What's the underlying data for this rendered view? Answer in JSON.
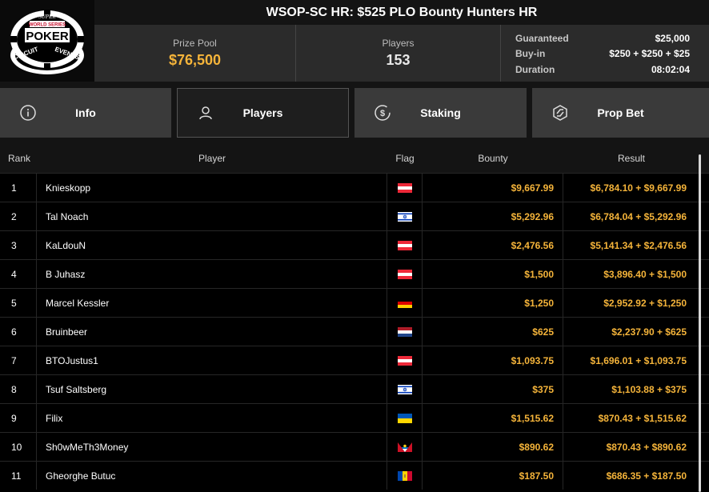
{
  "header": {
    "title": "WSOP-SC HR: $525 PLO Bounty Hunters HR",
    "logo": {
      "top_text": "SUPER",
      "middle_top": "WORLD SERIES",
      "brand": "POKER",
      "left_arc": "CIRCUIT",
      "right_arc": "EVENTS"
    }
  },
  "stats": {
    "prize_pool_label": "Prize Pool",
    "prize_pool_value": "$76,500",
    "players_label": "Players",
    "players_value": "153",
    "details": [
      {
        "label": "Guaranteed",
        "value": "$25,000"
      },
      {
        "label": "Buy-in",
        "value": "$250 + $250 + $25"
      },
      {
        "label": "Duration",
        "value": "08:02:04"
      }
    ]
  },
  "tabs": [
    {
      "label": "Info",
      "icon": "info-icon",
      "active": false
    },
    {
      "label": "Players",
      "icon": "user-icon",
      "active": true
    },
    {
      "label": "Staking",
      "icon": "dollar-coin-icon",
      "active": false
    },
    {
      "label": "Prop Bet",
      "icon": "prop-bet-icon",
      "active": false
    }
  ],
  "table": {
    "headers": {
      "rank": "Rank",
      "player": "Player",
      "flag": "Flag",
      "bounty": "Bounty",
      "result": "Result"
    },
    "rows": [
      {
        "rank": "1",
        "player": "Knieskopp",
        "flag": "austria",
        "bounty": "$9,667.99",
        "result": "$6,784.10 + $9,667.99"
      },
      {
        "rank": "2",
        "player": "Tal Noach",
        "flag": "israel",
        "bounty": "$5,292.96",
        "result": "$6,784.04 + $5,292.96"
      },
      {
        "rank": "3",
        "player": "KaLdouN",
        "flag": "austria",
        "bounty": "$2,476.56",
        "result": "$5,141.34 + $2,476.56"
      },
      {
        "rank": "4",
        "player": "B Juhasz",
        "flag": "austria",
        "bounty": "$1,500",
        "result": "$3,896.40 + $1,500"
      },
      {
        "rank": "5",
        "player": "Marcel Kessler",
        "flag": "germany",
        "bounty": "$1,250",
        "result": "$2,952.92 + $1,250"
      },
      {
        "rank": "6",
        "player": "Bruinbeer",
        "flag": "netherlands",
        "bounty": "$625",
        "result": "$2,237.90 + $625"
      },
      {
        "rank": "7",
        "player": "BTOJustus1",
        "flag": "austria",
        "bounty": "$1,093.75",
        "result": "$1,696.01 + $1,093.75"
      },
      {
        "rank": "8",
        "player": "Tsuf Saltsberg",
        "flag": "israel",
        "bounty": "$375",
        "result": "$1,103.88 + $375"
      },
      {
        "rank": "9",
        "player": "Filix",
        "flag": "ukraine",
        "bounty": "$1,515.62",
        "result": "$870.43 + $1,515.62"
      },
      {
        "rank": "10",
        "player": "Sh0wMeTh3Money",
        "flag": "antigua-and-barbuda",
        "bounty": "$890.62",
        "result": "$870.43 + $890.62"
      },
      {
        "rank": "11",
        "player": "Gheorghe Butuc",
        "flag": "moldova",
        "bounty": "$187.50",
        "result": "$686.35 + $187.50"
      }
    ]
  },
  "colors": {
    "gold": "#f5b43a",
    "panel": "#2b2b2b",
    "tab": "#3a3a3a",
    "background": "#141414"
  }
}
